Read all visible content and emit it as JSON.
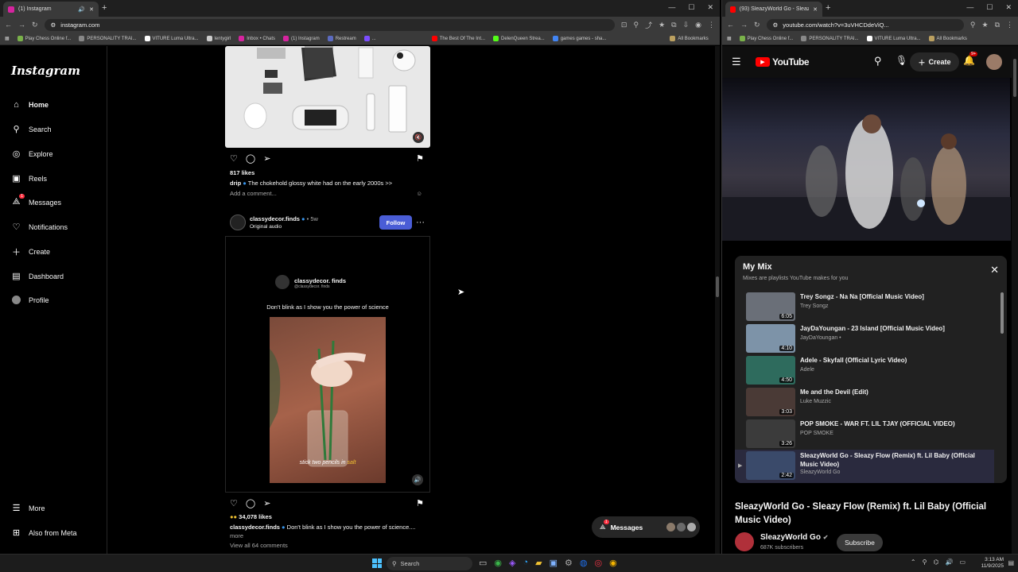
{
  "left_browser": {
    "tab_title": "(1) Instagram",
    "url": "instagram.com",
    "bookmarks": [
      "Play Chess Online f...",
      "PERSONALITY TRAI...",
      "VITURE Luma Ultra...",
      "lentygirl",
      "Inbox • Chats",
      "(1) Instagram",
      "Restream",
      "...",
      "The Best Of The Int...",
      "DelenQueen Strea...",
      "games games - sha...",
      "All Bookmarks"
    ]
  },
  "instagram": {
    "logo": "Instagram",
    "nav": [
      {
        "label": "Home",
        "icon": "home-icon"
      },
      {
        "label": "Search",
        "icon": "search-icon"
      },
      {
        "label": "Explore",
        "icon": "compass-icon"
      },
      {
        "label": "Reels",
        "icon": "reels-icon"
      },
      {
        "label": "Messages",
        "icon": "messenger-icon",
        "badge": "1"
      },
      {
        "label": "Notifications",
        "icon": "heart-icon"
      },
      {
        "label": "Create",
        "icon": "plus-icon"
      },
      {
        "label": "Dashboard",
        "icon": "dashboard-icon"
      },
      {
        "label": "Profile",
        "icon": "profile-avatar-icon"
      },
      {
        "label": "More",
        "icon": "menu-icon"
      },
      {
        "label": "Also from Meta",
        "icon": "meta-icon"
      }
    ],
    "post1": {
      "likes": "817 likes",
      "author": "drip",
      "caption": "The chokehold glossy white had on the early 2000s >>",
      "add_comment": "Add a comment..."
    },
    "post2": {
      "author": "classydecor.finds",
      "time": "• 5w",
      "audio": "Original audio",
      "follow": "Follow",
      "card_name": "classydecor. finds",
      "card_handle": "@classydecor. finds",
      "card_text": "Don't blink as I show you the power of science",
      "subtitle_a": "stick two pencils in",
      "subtitle_b": "salt",
      "likes": "34,078 likes",
      "caption": "Don't blink as I show you the power of science....",
      "more": "more",
      "comments": "View all 64 comments"
    },
    "messages_pill": {
      "label": "Messages",
      "badge": "1"
    }
  },
  "right_browser": {
    "tab_title": "(93) SleazyWorld Go - Sleazy F...",
    "url": "youtube.com/watch?v=3uVHCDdeViQ...",
    "bookmarks": [
      "Play Chess Online f...",
      "PERSONALITY TRAI...",
      "VITURE Luma Ultra...",
      "All Bookmarks"
    ]
  },
  "youtube": {
    "logo": "YouTube",
    "create": "Create",
    "notif_badge": "9+",
    "mix_title": "My Mix",
    "mix_sub": "Mixes are playlists YouTube makes for you",
    "items": [
      {
        "title": "Trey Songz - Na Na [Official Music Video]",
        "channel": "Trey Songz",
        "duration": "6:05",
        "color": "#6a6f78"
      },
      {
        "title": "JayDaYoungan - 23 Island [Official Music Video]",
        "channel": "JayDaYoungan •",
        "duration": "4:10",
        "color": "#7d93a8"
      },
      {
        "title": "Adele - Skyfall (Official Lyric Video)",
        "channel": "Adele",
        "duration": "4:50",
        "color": "#2e6b5d"
      },
      {
        "title": "Me and the Devil (Edit)",
        "channel": "Luke Muzzic",
        "duration": "3:03",
        "color": "#4a3a36"
      },
      {
        "title": "POP SMOKE - WAR FT. LIL TJAY (OFFICIAL VIDEO)",
        "channel": "POP SMOKE",
        "duration": "3:26",
        "color": "#3b3b3b"
      },
      {
        "title": "SleazyWorld Go - Sleazy Flow (Remix) ft. Lil Baby (Official Music Video)",
        "channel": "SleazyWorld Go",
        "duration": "2:42",
        "color": "#3a4a6a"
      }
    ],
    "video_title": "SleazyWorld Go - Sleazy Flow (Remix) ft. Lil Baby (Official Music Video)",
    "channel": "SleazyWorld Go",
    "subscribers": "687K subscribers",
    "subscribe": "Subscribe"
  },
  "taskbar": {
    "search": "Search",
    "time": "3:13 AM",
    "date": "11/9/2025"
  }
}
